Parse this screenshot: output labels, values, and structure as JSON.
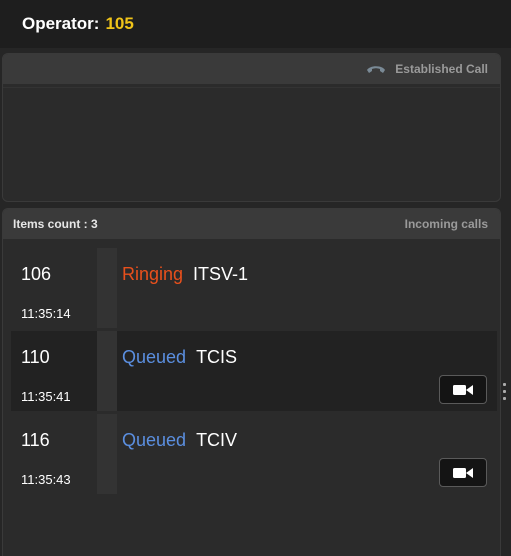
{
  "header": {
    "label": "Operator:",
    "operator_number": "105"
  },
  "established": {
    "title": "Established Call",
    "icon": "phone-hangup-icon"
  },
  "incoming": {
    "count_label": "Items count : 3",
    "title": "Incoming calls",
    "calls": [
      {
        "number": "106",
        "time": "11:35:14",
        "status": "Ringing",
        "name": "ITSV-1",
        "has_video": false
      },
      {
        "number": "110",
        "time": "11:35:41",
        "status": "Queued",
        "name": "TCIS",
        "has_video": true
      },
      {
        "number": "116",
        "time": "11:35:43",
        "status": "Queued",
        "name": "TCIV",
        "has_video": true
      }
    ]
  },
  "colors": {
    "operator_number": "#f0c419",
    "ringing": "#e8501c",
    "queued": "#5b8fe0"
  }
}
